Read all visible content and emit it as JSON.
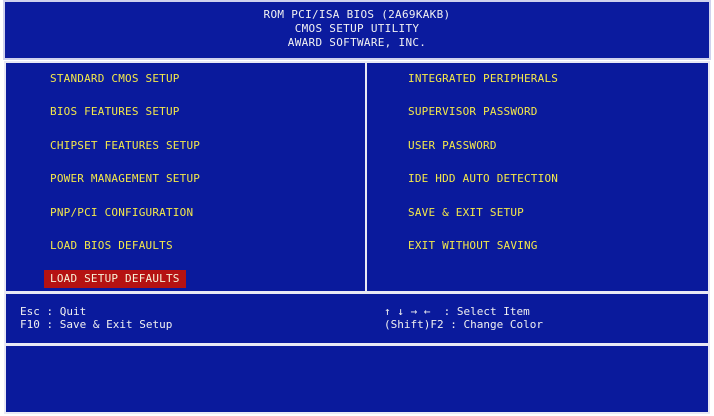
{
  "header": {
    "line1": "ROM PCI/ISA BIOS (2A69KAKB)",
    "line2": "CMOS SETUP UTILITY",
    "line3": "AWARD SOFTWARE, INC."
  },
  "menu": {
    "left": [
      "STANDARD CMOS SETUP",
      "BIOS FEATURES SETUP",
      "CHIPSET FEATURES SETUP",
      "POWER MANAGEMENT SETUP",
      "PNP/PCI CONFIGURATION",
      "LOAD BIOS DEFAULTS",
      "LOAD SETUP DEFAULTS"
    ],
    "right": [
      "INTEGRATED PERIPHERALS",
      "SUPERVISOR PASSWORD",
      "USER PASSWORD",
      "IDE HDD AUTO DETECTION",
      "SAVE & EXIT SETUP",
      "EXIT WITHOUT SAVING"
    ],
    "selected": "LOAD SETUP DEFAULTS"
  },
  "help": {
    "esc": "Esc : Quit",
    "f10": "F10 : Save & Exit Setup",
    "arrows": "↑ ↓ → ←  : Select Item",
    "shiftf2": "(Shift)F2 : Change Color"
  },
  "status": {
    "text": ""
  },
  "colors": {
    "background": "#0a1a9c",
    "item_text": "#f4e84a",
    "selected_bg": "#b51212",
    "border": "#e8e8f4"
  }
}
